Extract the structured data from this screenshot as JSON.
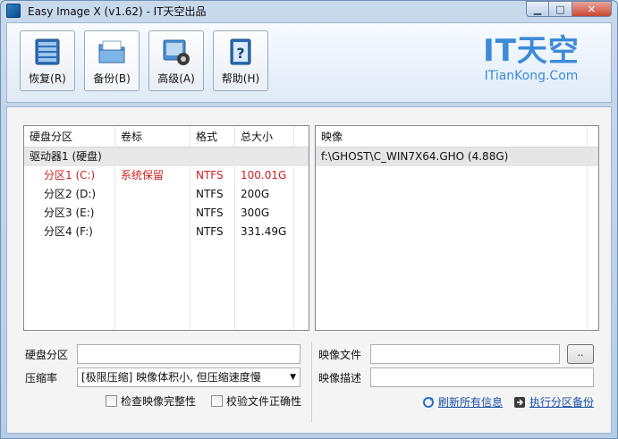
{
  "window": {
    "title": "Easy Image X (v1.62) - IT天空出品",
    "controls": {
      "minimize": "▁",
      "maximize": "□",
      "close": "✕"
    }
  },
  "toolbar": {
    "buttons": [
      {
        "label": "恢复(R)",
        "icon": "restore-grid-icon"
      },
      {
        "label": "备份(B)",
        "icon": "backup-folder-icon"
      },
      {
        "label": "高级(A)",
        "icon": "advanced-gear-icon"
      },
      {
        "label": "帮助(H)",
        "icon": "help-book-icon"
      }
    ],
    "logo": {
      "main": "IT天空",
      "sub": "ITianKong.Com",
      "color": "#3d8ad8"
    }
  },
  "partition_list": {
    "columns": [
      "硬盘分区",
      "卷标",
      "格式",
      "总大小"
    ],
    "group": "驱动器1 (硬盘)",
    "rows": [
      {
        "partition": "分区1 (C:)",
        "label": "系统保留",
        "format": "NTFS",
        "size": "100.01G",
        "highlight": true
      },
      {
        "partition": "分区2 (D:)",
        "label": "",
        "format": "NTFS",
        "size": "200G",
        "highlight": false
      },
      {
        "partition": "分区3 (E:)",
        "label": "",
        "format": "NTFS",
        "size": "300G",
        "highlight": false
      },
      {
        "partition": "分区4 (F:)",
        "label": "",
        "format": "NTFS",
        "size": "331.49G",
        "highlight": false
      }
    ]
  },
  "image_list": {
    "columns": [
      "映像"
    ],
    "rows": [
      "f:\\GHOST\\C_WIN7X64.GHO (4.88G)"
    ]
  },
  "form": {
    "partition_label": "硬盘分区",
    "partition_value": "",
    "compression_label": "压缩率",
    "compression_value": "[极限压缩] 映像体积小, 但压缩速度慢",
    "check_integrity": "检查映像完整性",
    "verify_files": "校验文件正确性",
    "image_file_label": "映像文件",
    "image_file_value": "",
    "browse_label": "..",
    "image_desc_label": "映像描述",
    "image_desc_value": "",
    "refresh_link": "刷新所有信息",
    "execute_link": "执行分区备份"
  },
  "colors": {
    "accent": "#3d8ad8",
    "highlight_text": "#d02020",
    "link": "#1a4ea8"
  }
}
